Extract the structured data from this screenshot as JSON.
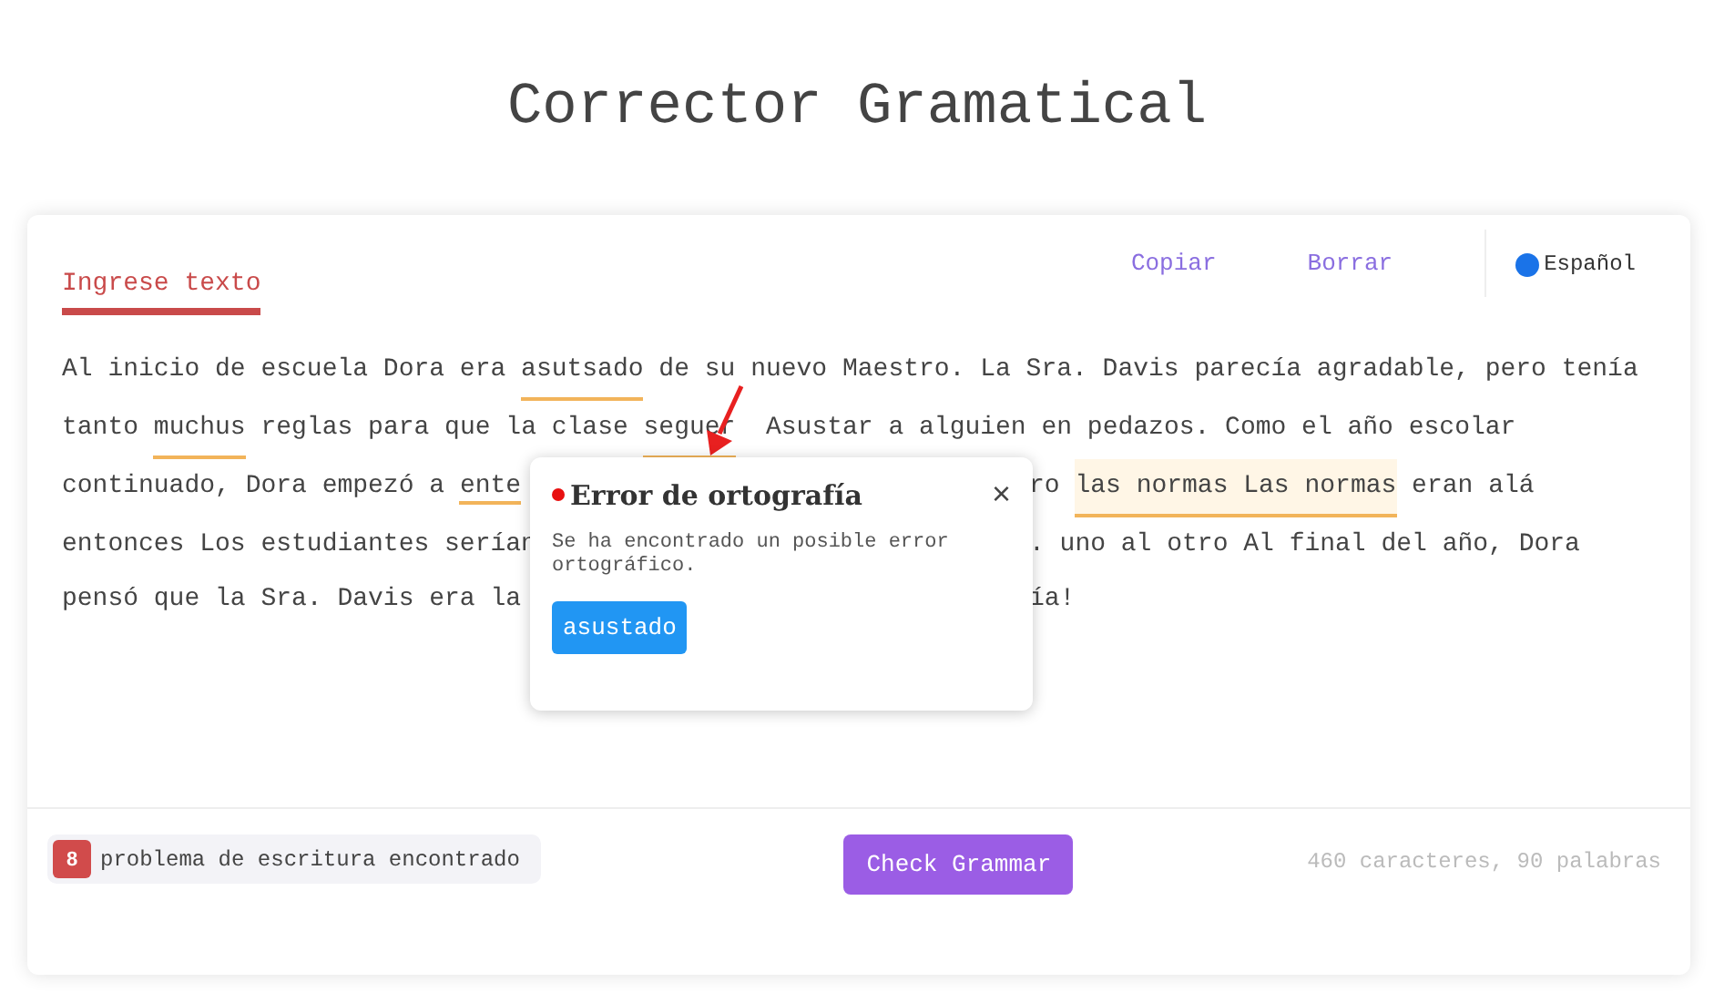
{
  "title": "Corrector Gramatical",
  "tabs": [
    {
      "label": "Ingrese texto",
      "selected": true
    }
  ],
  "actions": [
    "Copiar",
    "Borrar"
  ],
  "language": {
    "label": "Español"
  },
  "text_lines": [
    {
      "left": [
        {
          "text": "Al inicio de escuela Dora era ",
          "flagged": false
        },
        {
          "text": "asutsado",
          "flagged": true
        },
        {
          "text": " de su nuevo Maestro. La Sra. Davis parecía agradable, pero tenía",
          "flagged": false
        }
      ]
    },
    {
      "left": [
        {
          "text": "tanto ",
          "flagged": false
        },
        {
          "text": "muchus",
          "flagged": true
        },
        {
          "text": " reglas para que la clase ",
          "flagged": false
        },
        {
          "text": "seguer",
          "flagged": true
        },
        {
          "text": "  Asustar a alguien en pedazos. Como el año escolar",
          "flagged": false
        }
      ]
    },
    {
      "left": [
        {
          "text": "continuado, Dora empezó a ",
          "flagged": false
        },
        {
          "text": "ente",
          "flagged": true
        }
      ],
      "right": [
        {
          "text": "ro ",
          "flagged": false
        },
        {
          "text": "las normas Las normas",
          "flagged": true
        },
        {
          "text": " eran alá",
          "flagged": false
        }
      ]
    },
    {
      "left": [
        {
          "text": "entonces Los estudiantes serían",
          "flagged": false
        }
      ],
      "right": [
        {
          "text": ". uno al otro Al final del año, Dora",
          "flagged": false
        }
      ]
    },
    {
      "left": [
        {
          "text": "pensó que la Sra. Davis era la",
          "flagged": false
        }
      ],
      "right": [
        {
          "text": "ía!",
          "flagged": false
        }
      ]
    }
  ],
  "popup": {
    "title": "Error de ortografía",
    "close": "×",
    "message": "Se ha encontrado un posible error ortográfico.",
    "suggestion": "asustado"
  },
  "footer": {
    "issue_count": "8",
    "issue_label": "problema de escritura encontrado",
    "button": "Check Grammar",
    "stats": "460 caracteres, 90 palabras"
  }
}
